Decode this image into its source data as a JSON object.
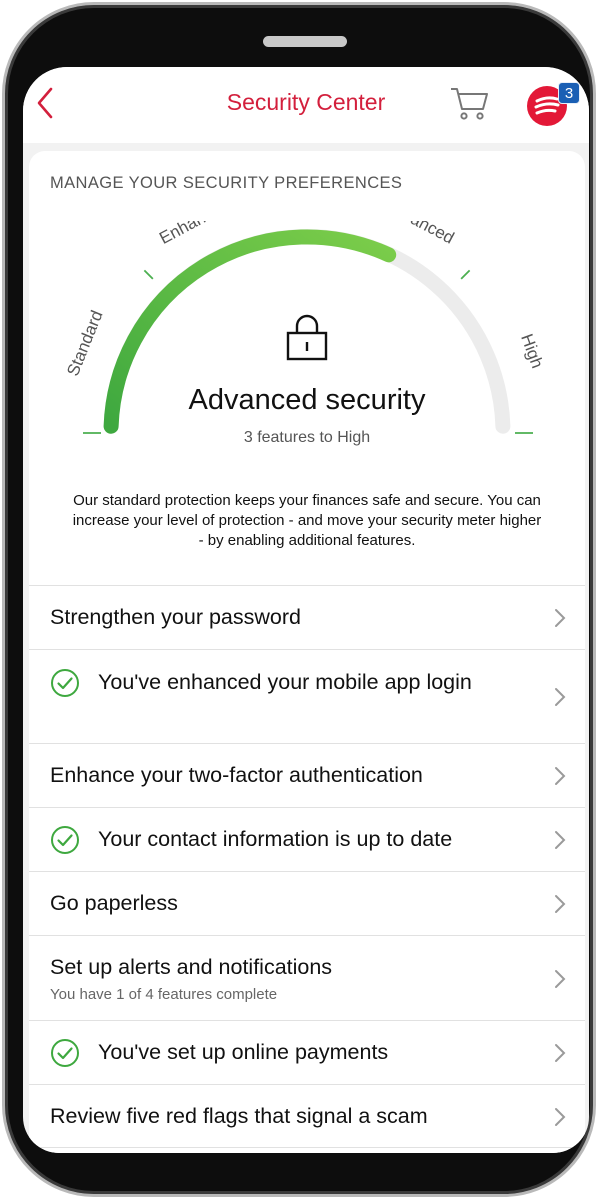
{
  "header": {
    "title": "Security Center",
    "badge_count": "3",
    "accent_color": "#d31f3c"
  },
  "security": {
    "heading": "MANAGE YOUR SECURITY PREFERENCES",
    "levels": [
      "Standard",
      "Enhanced",
      "Advanced",
      "High"
    ],
    "current_level": "Advanced",
    "progress_fraction": 0.64,
    "title": "Advanced security",
    "subtitle": "3 features to High",
    "description": "Our standard protection keeps your finances safe and secure. You can increase your level of protection - and move your security meter higher - by enabling additional features."
  },
  "items": [
    {
      "title": "Strengthen your password",
      "done": false
    },
    {
      "title": "You've enhanced your mobile app login",
      "done": true
    },
    {
      "title": "Enhance your two-factor authentication",
      "done": false
    },
    {
      "title": "Your contact information is up to date",
      "done": true
    },
    {
      "title": "Go paperless",
      "done": false
    },
    {
      "title": "Set up alerts and notifications",
      "subtitle": "You have 1 of 4 features complete",
      "done": false
    },
    {
      "title": "You've set up online payments",
      "done": true
    },
    {
      "title": "Review five red flags that signal a scam",
      "done": false
    }
  ]
}
